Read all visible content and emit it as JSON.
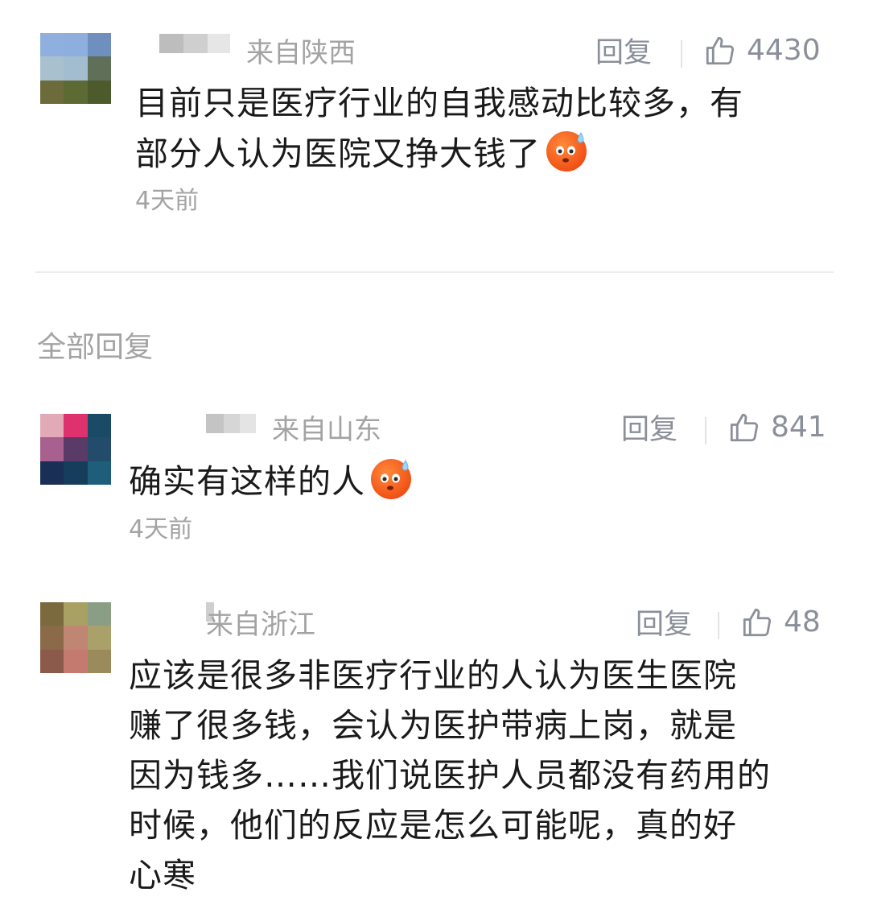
{
  "top_comment": {
    "location": "来自陕西",
    "reply_label": "回复",
    "likes": "4430",
    "lines": [
      "目前只是医疗行业的自我感动比较多，有",
      "部分人认为医院又挣大钱了"
    ],
    "emoji": "sweat-face-emoji",
    "time": "4天前"
  },
  "section_title": "全部回复",
  "replies": [
    {
      "location": "来自山东",
      "reply_label": "回复",
      "likes": "841",
      "lines": [
        "确实有这样的人"
      ],
      "emoji": "sweat-face-emoji",
      "time": "4天前"
    },
    {
      "location": "来自浙江",
      "reply_label": "回复",
      "likes": "48",
      "lines": [
        "应该是很多非医疗行业的人认为医生医院",
        "赚了很多钱，会认为医护带病上岗，就是",
        "因为钱多……我们说医护人员都没有药用的",
        "时候，他们的反应是怎么可能呢，真的好",
        "心寒"
      ]
    }
  ],
  "icons": {
    "like": "thumbs-up-icon"
  }
}
